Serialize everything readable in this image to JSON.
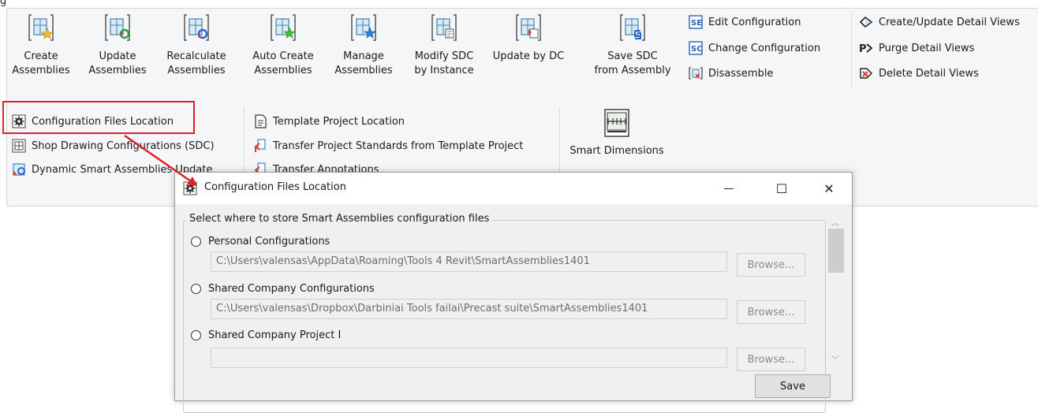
{
  "top_text": "g",
  "ribbon": {
    "big_buttons": [
      {
        "label": "Create\nAssemblies",
        "icon": "create-assemblies-icon"
      },
      {
        "label": "Update\nAssemblies",
        "icon": "update-assemblies-icon"
      },
      {
        "label": "Recalculate\nAssemblies",
        "icon": "recalculate-assemblies-icon"
      },
      {
        "label": "Auto Create\nAssemblies",
        "icon": "auto-create-assemblies-icon"
      },
      {
        "label": "Manage\nAssemblies",
        "icon": "manage-assemblies-icon"
      },
      {
        "label": "Modify SDC\nby Instance",
        "icon": "modify-sdc-icon"
      },
      {
        "label": "Update by DC",
        "icon": "update-by-dc-icon"
      },
      {
        "label": "Save SDC\nfrom Assembly",
        "icon": "save-sdc-icon"
      }
    ],
    "config_items": [
      {
        "label": "Edit Configuration",
        "icon": "edit-configuration-icon"
      },
      {
        "label": "Change Configuration",
        "icon": "change-configuration-icon"
      },
      {
        "label": "Disassemble",
        "icon": "disassemble-icon"
      }
    ],
    "detail_items": [
      {
        "label": "Create/Update Detail Views",
        "icon": "create-detail-views-icon"
      },
      {
        "label": "Purge Detail Views",
        "icon": "purge-detail-views-icon"
      },
      {
        "label": "Delete Detail Views",
        "icon": "delete-detail-views-icon"
      }
    ],
    "settings_items": [
      {
        "label": "Configuration Files Location",
        "icon": "gear-icon"
      },
      {
        "label": "Shop Drawing Configurations (SDC)",
        "icon": "sdc-icon"
      },
      {
        "label": "Dynamic Smart Assemblies Update",
        "icon": "dynamic-update-icon"
      }
    ],
    "template_items": [
      {
        "label": "Template Project Location",
        "icon": "template-icon"
      },
      {
        "label": "Transfer Project Standards from Template Project",
        "icon": "transfer-standards-icon"
      },
      {
        "label": "Transfer Annotations",
        "icon": "transfer-annotations-icon"
      }
    ],
    "smart_dimensions": {
      "label": "Smart Dimensions",
      "icon": "smart-dimensions-icon"
    }
  },
  "dialog": {
    "title": "Configuration Files Location",
    "minimize": "—",
    "maximize": "☐",
    "close": "✕",
    "group_label": "Select where to store Smart Assemblies configuration files",
    "options": [
      {
        "label": "Personal Configurations",
        "path": "C:\\Users\\valensas\\AppData\\Roaming\\Tools 4 Revit\\SmartAssemblies1401",
        "browse": "Browse..."
      },
      {
        "label": "Shared Company Configurations",
        "path": "C:\\Users\\valensas\\Dropbox\\Darbiniai Tools failai\\Precast suite\\SmartAssemblies1401",
        "browse": "Browse..."
      },
      {
        "label": "Shared Company Project I",
        "path": "",
        "browse": "Browse..."
      }
    ],
    "save": "Save"
  },
  "colors": {
    "highlight": "#e21e26",
    "arrow": "#e21e26",
    "ribbon_bg": "#f5f6f7"
  }
}
